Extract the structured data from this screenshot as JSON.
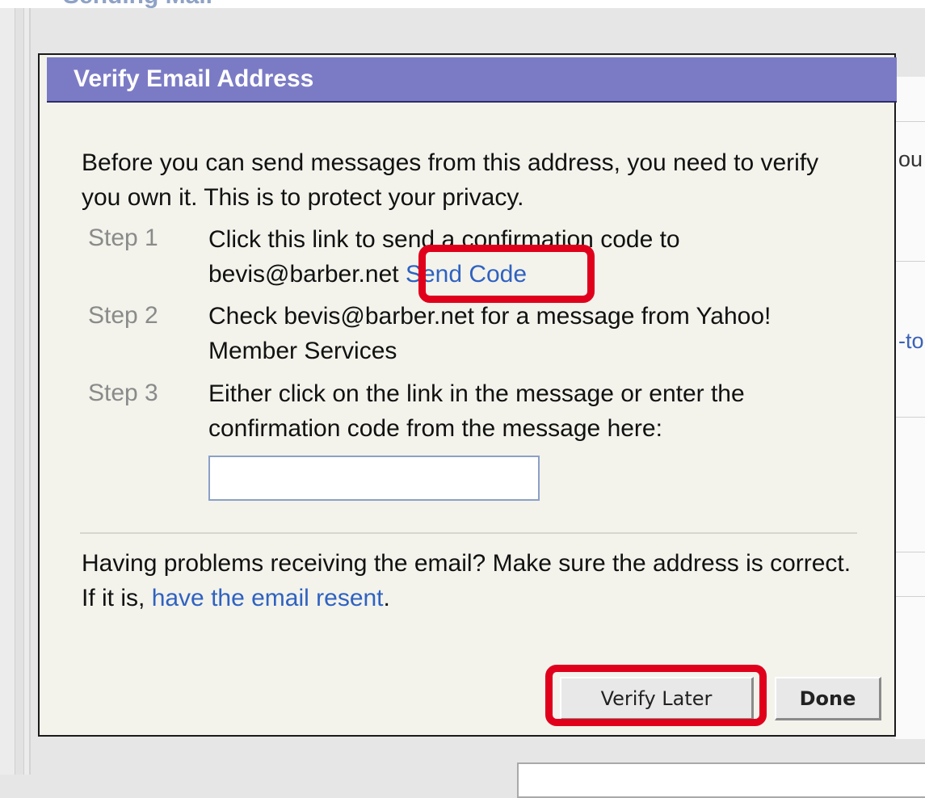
{
  "background": {
    "heading_partial": "Sending Mail",
    "right_fragments": [
      "ou",
      "-to"
    ]
  },
  "dialog": {
    "title": "Verify Email Address",
    "intro": "Before you can send messages from this address, you need to verify you own it. This is to protect your privacy.",
    "steps": [
      {
        "label": "Step 1",
        "text_before": "Click this link to send a confirmation code to bevis@barber.net",
        "link": "Send Code"
      },
      {
        "label": "Step 2",
        "text": "Check bevis@barber.net for a message from Yahoo! Member Services"
      },
      {
        "label": "Step 3",
        "text": "Either click on the link in the message or enter the confirmation code from the message here:"
      }
    ],
    "code_input": {
      "value": "",
      "placeholder": ""
    },
    "problems_text": "Having problems receiving the email? Make sure the address is correct. If it is,",
    "resend_link": "have the email resent",
    "resend_suffix": ".",
    "buttons": {
      "verify_later": "Verify Later",
      "done": "Done"
    }
  },
  "colors": {
    "title_bar": "#7b7bc5",
    "link": "#2f62c0",
    "highlight": "#e0001b",
    "dialog_bg": "#f3f3ec"
  }
}
